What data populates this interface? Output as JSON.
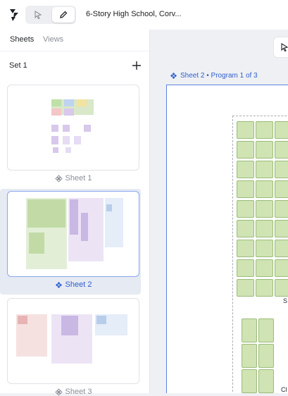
{
  "header": {
    "title": "6-Story High School, Corv...",
    "logo_icon": "app-logo-icon",
    "modes": [
      {
        "name": "select-mode",
        "icon": "cursor-pointer-icon",
        "active": false
      },
      {
        "name": "edit-mode",
        "icon": "pencil-icon",
        "active": true
      }
    ]
  },
  "panel": {
    "tabs": [
      {
        "label": "Sheets",
        "active": true
      },
      {
        "label": "Views",
        "active": false
      }
    ],
    "set_label": "Set 1",
    "add_icon": "plus-icon",
    "sheets": [
      {
        "label": "Sheet 1",
        "selected": false
      },
      {
        "label": "Sheet 2",
        "selected": true
      },
      {
        "label": "Sheet 3",
        "selected": false
      }
    ]
  },
  "canvas": {
    "sheet_label": "Sheet 2 • Program 1 of 3",
    "bottom_labels": [
      "S",
      "Cl"
    ]
  },
  "colors": {
    "accent": "#2f5fcf",
    "selected_border": "#8aa8f0",
    "cell_fill": "#cfe3b3",
    "cell_border": "#9cbc7b"
  }
}
